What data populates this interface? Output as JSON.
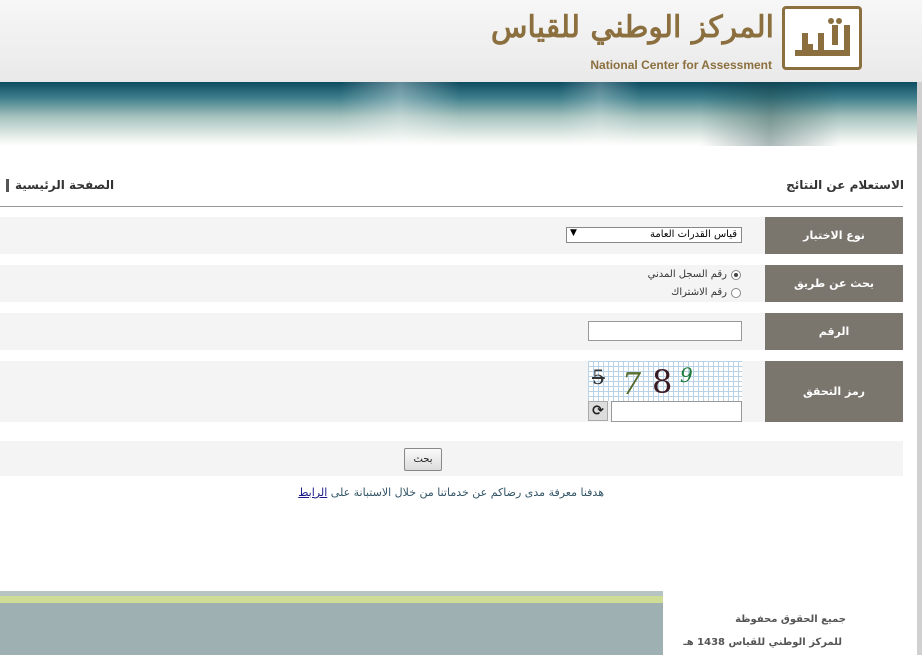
{
  "header": {
    "logo_arabic": "المركز الوطني للقياس",
    "logo_english": "National Center for Assessment",
    "logo_icon": "qiyas-logo-icon"
  },
  "page": {
    "title": "الاستعلام عن النتائج",
    "home_link": "الصفحة الرئيسية"
  },
  "form": {
    "exam_type_label": "نوع الاختبار",
    "exam_type_value": "قياس القدرات العامة",
    "search_by_label": "بحث عن طريق",
    "search_options": [
      "رقم السجل المدني",
      "رقم الاشتراك"
    ],
    "search_selected": 0,
    "number_label": "الرقم",
    "number_value": "",
    "captcha_label": "رمز التحقق",
    "captcha_chars": [
      "5",
      "7",
      "8",
      "9"
    ],
    "captcha_input_value": "",
    "refresh_icon": "refresh-icon",
    "submit_label": "بحث"
  },
  "survey": {
    "text": "هدفنا معرفة مدى رضاكم عن خدماتنا من خلال الاستبانة على",
    "link_text": "الرابط"
  },
  "footer": {
    "line1": "جميع الحقوق محفوظة",
    "line2": "للمركز الوطني للقياس 1438 هـ"
  },
  "colors": {
    "brand": "#8b6f3e",
    "label_bg": "#7a756d",
    "row_bg": "#f4f4f4"
  }
}
